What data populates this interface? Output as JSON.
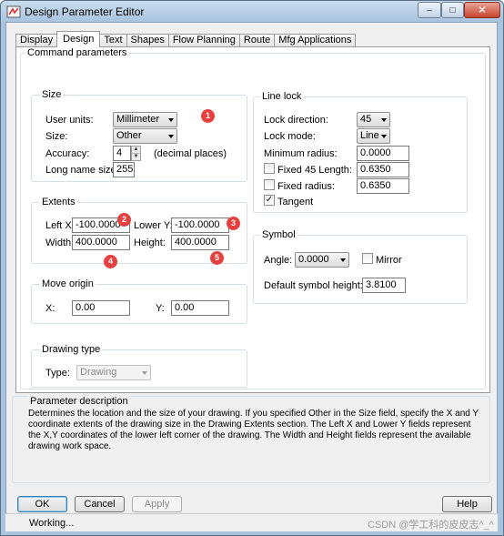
{
  "window": {
    "title": "Design Parameter Editor",
    "app_icon": "app-icon",
    "minimize": "minimize-icon",
    "maximize": "maximize-icon",
    "close": "close-icon"
  },
  "tabs": [
    {
      "label": "Display",
      "active": false
    },
    {
      "label": "Design",
      "active": true
    },
    {
      "label": "Text",
      "active": false
    },
    {
      "label": "Shapes",
      "active": false
    },
    {
      "label": "Flow Planning",
      "active": false
    },
    {
      "label": "Route",
      "active": false
    },
    {
      "label": "Mfg Applications",
      "active": false
    }
  ],
  "command_parameters": {
    "caption": "Command parameters",
    "size": {
      "caption": "Size",
      "user_units_label": "User units:",
      "user_units_value": "Millimeter",
      "size_label": "Size:",
      "size_value": "Other",
      "accuracy_label": "Accuracy:",
      "accuracy_value": "4",
      "accuracy_suffix": "(decimal places)",
      "long_name_label": "Long name size:",
      "long_name_value": "255"
    },
    "extents": {
      "caption": "Extents",
      "left_x_label": "Left X:",
      "left_x_value": "-100.0000",
      "lower_y_label": "Lower Y:",
      "lower_y_value": "-100.0000",
      "width_label": "Width:",
      "width_value": "400.0000",
      "height_label": "Height:",
      "height_value": "400.0000"
    },
    "move_origin": {
      "caption": "Move origin",
      "x_label": "X:",
      "x_value": "0.00",
      "y_label": "Y:",
      "y_value": "0.00"
    },
    "drawing_type": {
      "caption": "Drawing type",
      "type_label": "Type:",
      "type_value": "Drawing"
    },
    "line_lock": {
      "caption": "Line lock",
      "direction_label": "Lock direction:",
      "direction_value": "45",
      "mode_label": "Lock mode:",
      "mode_value": "Line",
      "min_radius_label": "Minimum radius:",
      "min_radius_value": "0.0000",
      "fixed45_label": "Fixed 45 Length:",
      "fixed45_value": "0.6350",
      "fixed45_checked": false,
      "fixed_radius_label": "Fixed radius:",
      "fixed_radius_value": "0.6350",
      "fixed_radius_checked": false,
      "tangent_label": "Tangent",
      "tangent_checked": true
    },
    "symbol": {
      "caption": "Symbol",
      "angle_label": "Angle:",
      "angle_value": "0.0000",
      "mirror_label": "Mirror",
      "mirror_checked": false,
      "default_height_label": "Default symbol height:",
      "default_height_value": "3.8100"
    }
  },
  "markers": [
    "1",
    "2",
    "3",
    "4",
    "5"
  ],
  "parameter_description": {
    "caption": "Parameter description",
    "text": "Determines the location and the size of your drawing. If you specified Other in the Size field, specify the X and Y coordinate extents of the drawing size in the Drawing Extents section. The Left X and Lower Y fields represent the X,Y coordinates of the lower left corner of the drawing. The Width and Height fields represent the available drawing work space."
  },
  "buttons": {
    "ok": "OK",
    "cancel": "Cancel",
    "apply": "Apply",
    "help": "Help"
  },
  "status": {
    "text": "Working..."
  },
  "watermark": "CSDN @学工科的皮皮志^_^",
  "glyphs": {
    "checkmark": "✓",
    "minimize": "–",
    "maximize": "□",
    "close": "✕",
    "spin_up": "▲",
    "spin_down": "▼"
  }
}
